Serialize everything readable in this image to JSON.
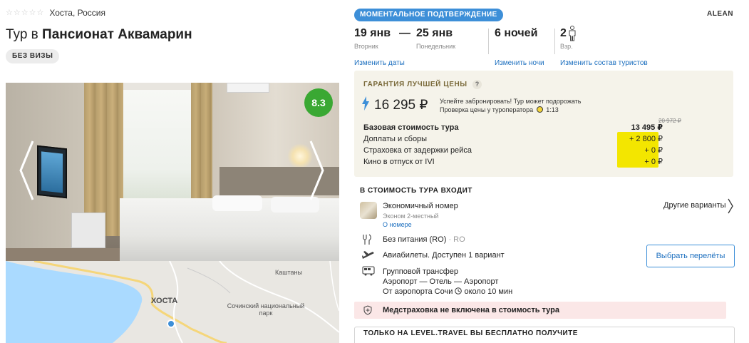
{
  "hotel": {
    "stars": 5,
    "location": "Хоста, Россия",
    "title_prefix": "Тур в",
    "title_name": "Пансионат Аквамарин",
    "visa_badge": "БЕЗ ВИЗЫ",
    "rating": "8.3"
  },
  "map": {
    "city": "ХОСТА",
    "labels": [
      "Каштаны",
      "Сочинский национальный парк"
    ]
  },
  "booking": {
    "confirm_badge": "МОМЕНТАЛЬНОЕ ПОДТВЕРЖДЕНИЕ",
    "operator": "ALEAN",
    "date_from": "19 янв",
    "date_from_day": "Вторник",
    "date_to": "25 янв",
    "date_to_day": "Понедельник",
    "dash": "—",
    "nights": "6 ночей",
    "tourists": "2",
    "tourists_sub": "Взр.",
    "change_dates": "Изменить даты",
    "change_nights": "Изменить ночи",
    "change_tourists": "Изменить состав туристов"
  },
  "price": {
    "guarantee": "ГАРАНТИЯ ЛУЧШЕЙ ЦЕНЫ",
    "help": "?",
    "total": "16 295 ₽",
    "note_line1": "Успейте забронировать! Тур может подорожать",
    "note_line2_pre": "Проверка цены у туроператора",
    "note_time": "1:13",
    "old_price": "20 972 ₽",
    "rows": [
      {
        "label": "Базовая стоимость тура",
        "value": "13 495 ₽",
        "bold": true
      },
      {
        "label": "Доплаты и сборы",
        "value": "+ 2 800 ₽",
        "bold": false
      },
      {
        "label": "Страховка от задержки рейса",
        "value": "+ 0 ₽",
        "bold": false
      },
      {
        "label": "Кино в отпуск от IVI",
        "value": "+ 0 ₽",
        "bold": false
      }
    ]
  },
  "includes": {
    "title": "В СТОИМОСТЬ ТУРА ВХОДИТ",
    "room_name": "Экономичный номер",
    "room_type": "Эконом 2-местный",
    "room_link": "О номере",
    "other_variants": "Другие варианты",
    "meal": "Без питания (RO)",
    "meal_code": "· RO",
    "flights": "Авиабилеты. Доступен 1 вариант",
    "flights_button": "Выбрать перелёты",
    "transfer_title": "Групповой трансфер",
    "transfer_route": "Аэропорт — Отель — Аэропорт",
    "transfer_time_pre": "От аэропорта Сочи",
    "transfer_time": "около 10 мин",
    "insurance": "Медстраховка не включена в стоимость тура",
    "promo_title": "ТОЛЬКО НА LEVEL.TRAVEL ВЫ БЕСПЛАТНО ПОЛУЧИТЕ"
  },
  "colors": {
    "accent": "#3d8fd8",
    "rating": "#3aa833",
    "highlight": "#f3e600",
    "price_box": "#f5f3ea",
    "warning": "#fbe7e7"
  }
}
